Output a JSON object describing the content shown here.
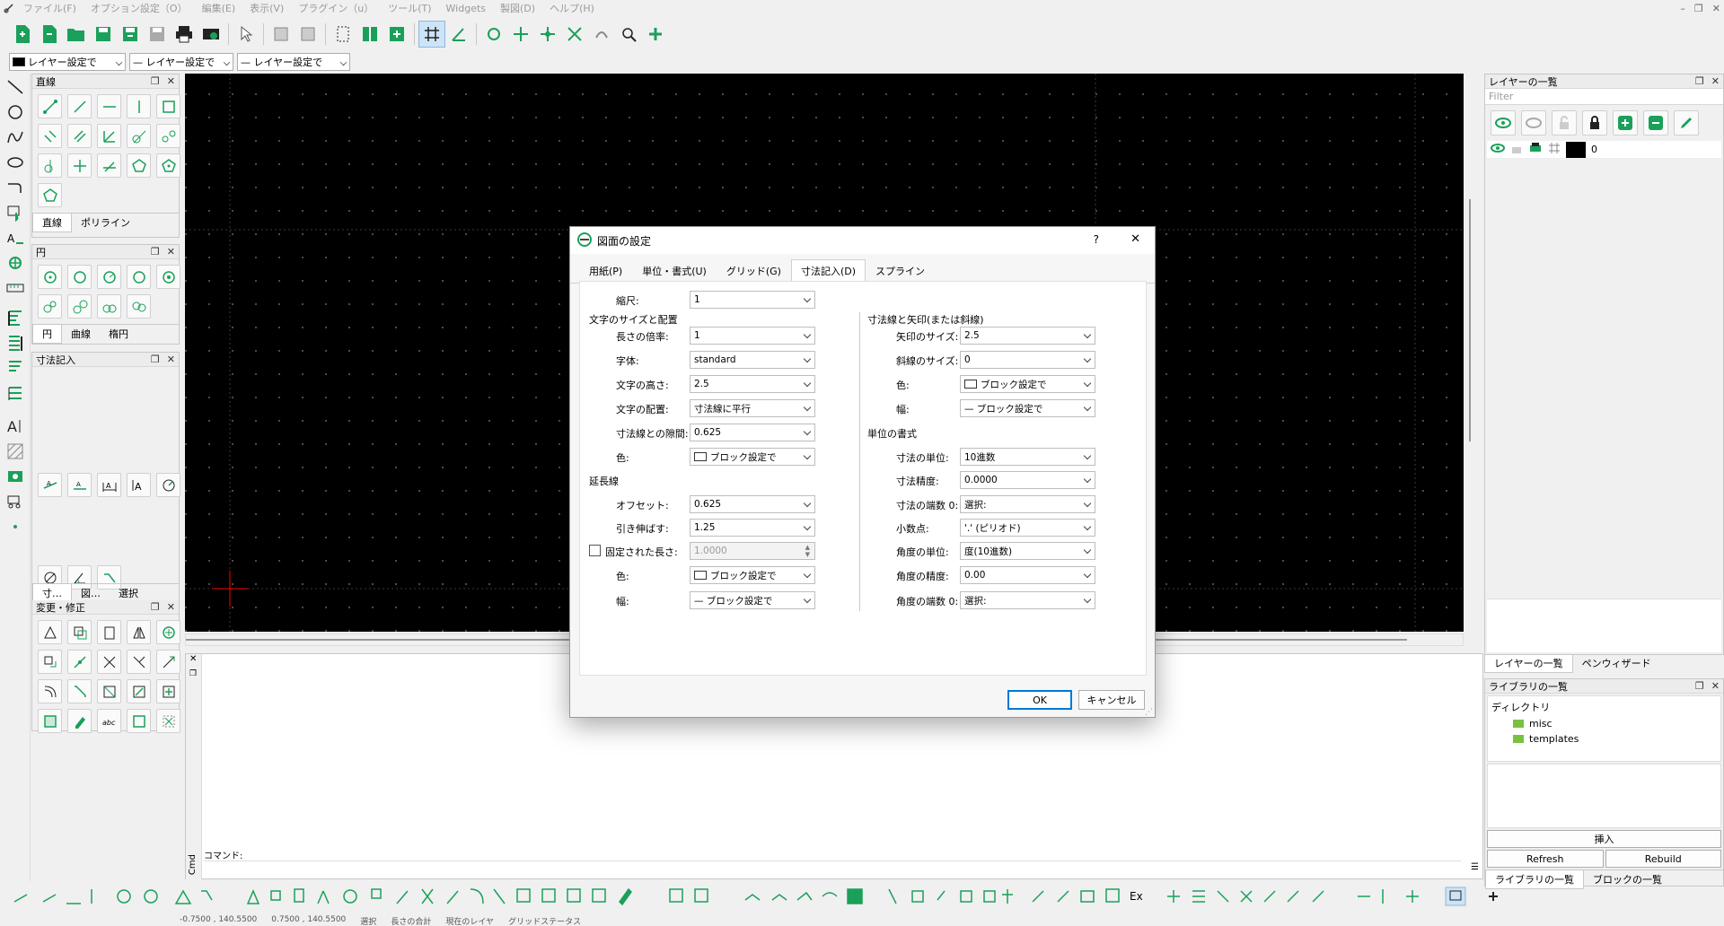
{
  "menu": [
    "ファイル(F)",
    "オプション設定（O）",
    "編集(E)",
    "表示(V)",
    "プラグイン（u）",
    "ツール(T)",
    "Widgets",
    "製図(D)",
    "ヘルプ(H)"
  ],
  "toolbar2": {
    "combo1": "レイヤー設定で",
    "combo2": "— レイヤー設定で",
    "combo3": "— レイヤー設定で"
  },
  "docks": {
    "line": {
      "title": "直線",
      "tabs": [
        "直線",
        "ポリライン"
      ]
    },
    "circle": {
      "title": "円",
      "tabs": [
        "円",
        "曲線",
        "楕円"
      ]
    },
    "dim": {
      "title": "寸法記入",
      "tabs": [
        "寸…",
        "図…",
        "選択"
      ]
    },
    "modify": {
      "title": "変更・修正"
    }
  },
  "right": {
    "layers_title": "レイヤーの一覧",
    "filter_placeholder": "Filter",
    "layer_name": "0",
    "tabs": [
      "レイヤーの一覧",
      "ペンウィザード"
    ],
    "library_title": "ライブラリの一覧",
    "dir_label": "ディレクトリ",
    "folders": [
      "misc",
      "templates"
    ],
    "insert": "挿入",
    "refresh": "Refresh",
    "rebuild": "Rebuild",
    "lib_tabs": [
      "ライブラリの一覧",
      "ブロックの一覧"
    ]
  },
  "cmd": {
    "label": "コマンド:",
    "side": "Cmd"
  },
  "dialog": {
    "title": "図面の設定",
    "help": "?",
    "close": "✕",
    "tabs": [
      "用紙(P)",
      "単位・書式(U)",
      "グリッド(G)",
      "寸法記入(D)",
      "スプライン"
    ],
    "scale_label": "縮尺:",
    "scale": "1",
    "text_section": "文字のサイズと配置",
    "len_factor_label": "長さの倍率:",
    "len_factor": "1",
    "font_label": "字体:",
    "font": "standard",
    "text_height_label": "文字の高さ:",
    "text_height": "2.5",
    "text_align_label": "文字の配置:",
    "text_align": "寸法線に平行",
    "gap_label": "寸法線との隙間:",
    "gap": "0.625",
    "color_label": "色:",
    "color": "ブロック設定で",
    "ext_section": "延長線",
    "offset_label": "オフセット:",
    "offset": "0.625",
    "extend_label": "引き伸ばす:",
    "extend": "1.25",
    "fixed_label": "固定された長さ:",
    "fixed": "1.0000",
    "ext_color_label": "色:",
    "ext_color": "ブロック設定で",
    "ext_width_label": "幅:",
    "ext_width": "— ブロック設定で",
    "arrow_section": "寸法線と矢印(または斜線)",
    "arrow_size_label": "矢印のサイズ:",
    "arrow_size": "2.5",
    "tick_size_label": "斜線のサイズ:",
    "tick_size": "0",
    "arrow_color_label": "色:",
    "arrow_color": "ブロック設定で",
    "arrow_width_label": "幅:",
    "arrow_width": "— ブロック設定で",
    "unit_section": "単位の書式",
    "dim_unit_label": "寸法の単位:",
    "dim_unit": "10進数",
    "dim_prec_label": "寸法精度:",
    "dim_prec": "0.0000",
    "dim_zero_label": "寸法の端数 0:",
    "dim_zero": "選択:",
    "decimal_label": "小数点:",
    "decimal": "'.' (ピリオド)",
    "angle_unit_label": "角度の単位:",
    "angle_unit": "度(10進数)",
    "angle_prec_label": "角度の精度:",
    "angle_prec": "0.00",
    "angle_zero_label": "角度の端数 0:",
    "angle_zero": "選択:",
    "ok": "OK",
    "cancel": "キャンセル"
  },
  "bottom": {
    "ex": "Ex"
  },
  "status": [
    "-0.7500 , 140.5500",
    "0.7500 , 140.5500",
    "選択",
    "長さの合計",
    "現在のレイヤ",
    "グリッドステータス"
  ],
  "colors": {
    "accent": "#1aa05a",
    "canvas": "#000000",
    "crosshair": "#ff0000"
  }
}
